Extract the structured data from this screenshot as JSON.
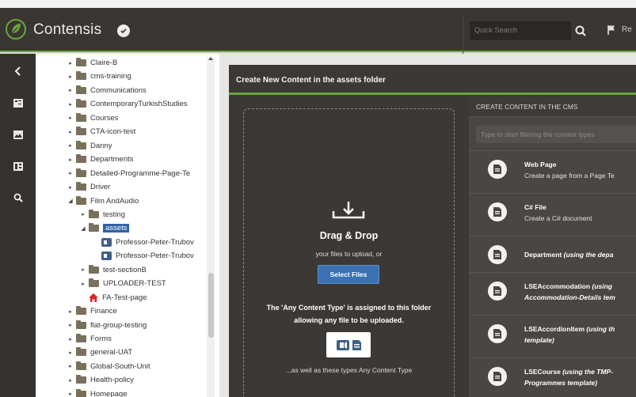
{
  "app": {
    "brand": "Contensis"
  },
  "topbar": {
    "search_placeholder": "Quick Search",
    "flag_label": "Re"
  },
  "tree": {
    "items": [
      {
        "label": "Claire-B",
        "type": "folder",
        "caret": "▸"
      },
      {
        "label": "cms-training",
        "type": "folder",
        "caret": "▸"
      },
      {
        "label": "Communications",
        "type": "folder",
        "caret": "▸"
      },
      {
        "label": "ContemporaryTurkishStudies",
        "type": "folder",
        "caret": "▸"
      },
      {
        "label": "Courses",
        "type": "folder",
        "caret": "▸"
      },
      {
        "label": "CTA-icon-test",
        "type": "folder",
        "caret": "▸"
      },
      {
        "label": "Danny",
        "type": "folder",
        "caret": "▸"
      },
      {
        "label": "Departments",
        "type": "folder",
        "caret": "▸"
      },
      {
        "label": "Detailed-Programme-Page-Te",
        "type": "folder",
        "caret": "▸"
      },
      {
        "label": "Driver",
        "type": "folder",
        "caret": "▸"
      },
      {
        "label": "Film AndAudio",
        "type": "folder",
        "caret": "◢"
      },
      {
        "label": "testing",
        "type": "folder",
        "caret": "▸"
      },
      {
        "label": "assets",
        "type": "folder",
        "caret": "◢",
        "selected": true
      },
      {
        "label": "Professor-Peter-Trubov",
        "type": "file",
        "caret": ""
      },
      {
        "label": "Professor-Peter-Trubov",
        "type": "file",
        "caret": ""
      },
      {
        "label": "test-sectionB",
        "type": "folder",
        "caret": "▸"
      },
      {
        "label": "UPLOADER-TEST",
        "type": "folder",
        "caret": "▸"
      },
      {
        "label": "FA-Test-page",
        "type": "home",
        "caret": ""
      },
      {
        "label": "Finance",
        "type": "folder",
        "caret": "▸"
      },
      {
        "label": "flat-group-testing",
        "type": "folder",
        "caret": "▸"
      },
      {
        "label": "Forms",
        "type": "folder",
        "caret": "▸"
      },
      {
        "label": "general-UAT",
        "type": "folder",
        "caret": "▸"
      },
      {
        "label": "Global-South-Unit",
        "type": "folder",
        "caret": "▸"
      },
      {
        "label": "Health-policy",
        "type": "folder",
        "caret": "▸"
      },
      {
        "label": "Homepage",
        "type": "folder",
        "caret": "▸"
      }
    ]
  },
  "main": {
    "title": "Create New Content in the assets folder",
    "drop": {
      "title": "Drag & Drop",
      "subtitle": "your files to upload, or",
      "button": "Select Files",
      "note": "The 'Any Content Type' is assigned to this folder allowing any file to be uploaded.",
      "footer": "...as well as these types Any Content Type"
    },
    "cms": {
      "title": "CREATE CONTENT IN THE CMS",
      "filter_placeholder": "Type to start filtering the content types",
      "types": [
        {
          "name": "Web Page",
          "desc": "Create a page from a Page Te",
          "italic": false
        },
        {
          "name": "C# File",
          "desc": "Create a C# document",
          "italic": false
        },
        {
          "name": "Department",
          "name_it": "(using the depa",
          "desc": "",
          "italic": true
        },
        {
          "name": "LSEAccommodation",
          "name_it": "(using",
          "desc": "Accommodation-Details tem",
          "italic": true
        },
        {
          "name": "LSEAccordionItem",
          "name_it": "(using th",
          "desc": "template)",
          "italic": true
        },
        {
          "name": "LSECourse",
          "name_it": "(using the TMP-",
          "desc": "Programmes template)",
          "italic": true
        }
      ]
    }
  },
  "colors": {
    "accent_green": "#6aa63a",
    "topbar": "#3a3633",
    "select_blue": "#3a72b3",
    "tree_selected": "#2f62a8"
  },
  "icons": [
    "leaf-logo-icon",
    "shield-check-icon",
    "search-icon",
    "flag-icon",
    "chevron-left-icon",
    "list-icon",
    "image-icon",
    "columns-icon",
    "search-icon",
    "download-tray-icon"
  ]
}
